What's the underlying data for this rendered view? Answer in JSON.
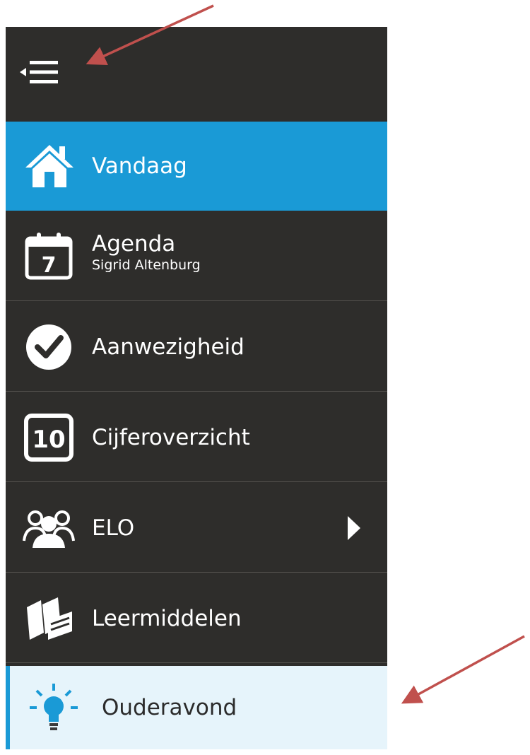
{
  "sidebar": {
    "toggle_icon": "collapse-menu-icon",
    "items": [
      {
        "label": "Vandaag",
        "icon": "home-icon",
        "state": "active"
      },
      {
        "label": "Agenda",
        "sublabel": "Sigrid Altenburg",
        "icon": "calendar-icon",
        "calendar_day": "7"
      },
      {
        "label": "Aanwezigheid",
        "icon": "checkmark-circle-icon"
      },
      {
        "label": "Cijferoverzicht",
        "icon": "grade-icon",
        "grade_number": "10"
      },
      {
        "label": "ELO",
        "icon": "group-icon",
        "has_submenu": true,
        "submenu_icon": "chevron-right-icon"
      },
      {
        "label": "Leermiddelen",
        "icon": "books-icon"
      },
      {
        "label": "Ouderavond",
        "icon": "lightbulb-icon",
        "state": "highlighted"
      }
    ]
  },
  "colors": {
    "sidebar_bg": "#2e2d2b",
    "active_bg": "#1a9ad6",
    "highlight_bg": "#e6f4fb",
    "divider": "#55534f",
    "annotation_arrow": "#c0504d"
  },
  "annotations": [
    {
      "type": "arrow",
      "points_to": "sidebar-toggle"
    },
    {
      "type": "arrow",
      "points_to": "nav-item-ouderavond"
    }
  ]
}
